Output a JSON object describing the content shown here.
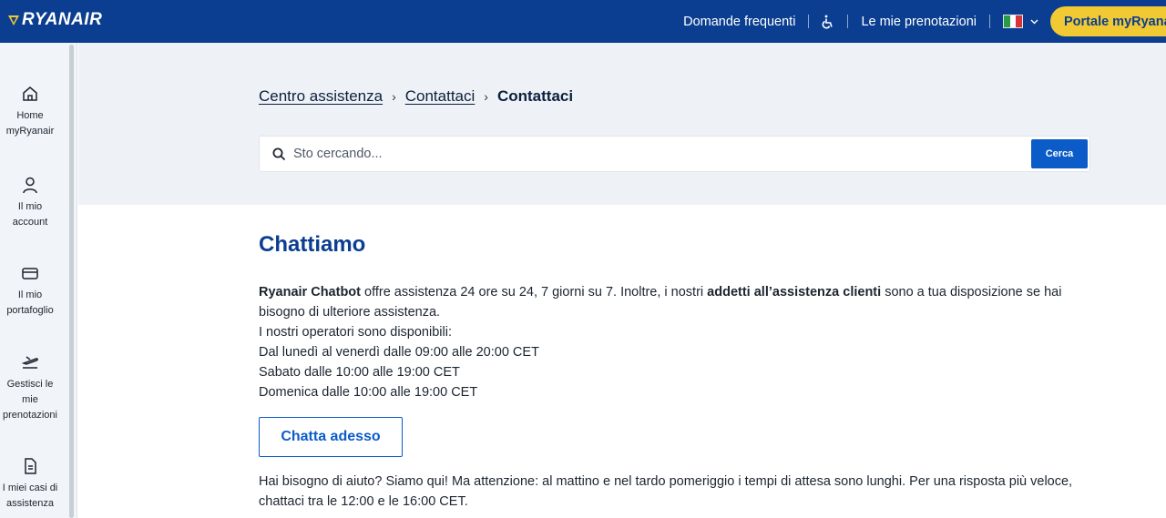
{
  "brand": {
    "name": "RYANAIR",
    "accent": "#0b3e91",
    "yellow": "#f1c933"
  },
  "topnav": {
    "faq": "Domande frequenti",
    "accessibility_icon": "wheelchair-icon",
    "bookings": "Le mie prenotazioni",
    "language_flag": "italy-flag",
    "portal": "Portale myRyanair"
  },
  "sidebar": {
    "items": [
      {
        "label_1": "Home",
        "label_2": "myRyanair",
        "icon": "home-icon"
      },
      {
        "label_1": "Il mio",
        "label_2": "account",
        "icon": "user-icon"
      },
      {
        "label_1": "Il mio",
        "label_2": "portafoglio",
        "icon": "wallet-icon"
      },
      {
        "label_1": "Gestisci le",
        "label_2": "mie",
        "label_3": "prenotazioni",
        "icon": "plane-departure-icon"
      },
      {
        "label_1": "I miei casi di",
        "label_2": "assistenza",
        "icon": "document-icon"
      }
    ]
  },
  "breadcrumb": {
    "items": [
      "Centro assistenza",
      "Contattaci"
    ],
    "current": "Contattaci"
  },
  "search": {
    "placeholder": "Sto cercando...",
    "button": "Cerca"
  },
  "main": {
    "title": "Chattiamo",
    "intro_bold_1": "Ryanair Chatbot",
    "intro_text_1": " offre assistenza 24 ore su 24, 7 giorni su 7. Inoltre, i nostri ",
    "intro_bold_2": "addetti all’assistenza clienti",
    "intro_text_2": " sono a tua disposizione se hai bisogno di ulteriore assistenza.",
    "hours_intro": "I nostri operatori sono disponibili:",
    "hours_weekdays": "Dal lunedì al venerdì dalle 09:00 alle 20:00 CET",
    "hours_saturday": "Sabato dalle 10:00 alle 19:00 CET",
    "hours_sunday": "Domenica dalle 10:00 alle 19:00 CET",
    "chat_button": "Chatta adesso",
    "help_text": "Hai bisogno di aiuto? Siamo qui! Ma attenzione: al mattino e nel tardo pomeriggio i tempi di attesa sono lunghi. Per una risposta più veloce, chattaci tra le 12:00 e le 16:00 CET."
  }
}
